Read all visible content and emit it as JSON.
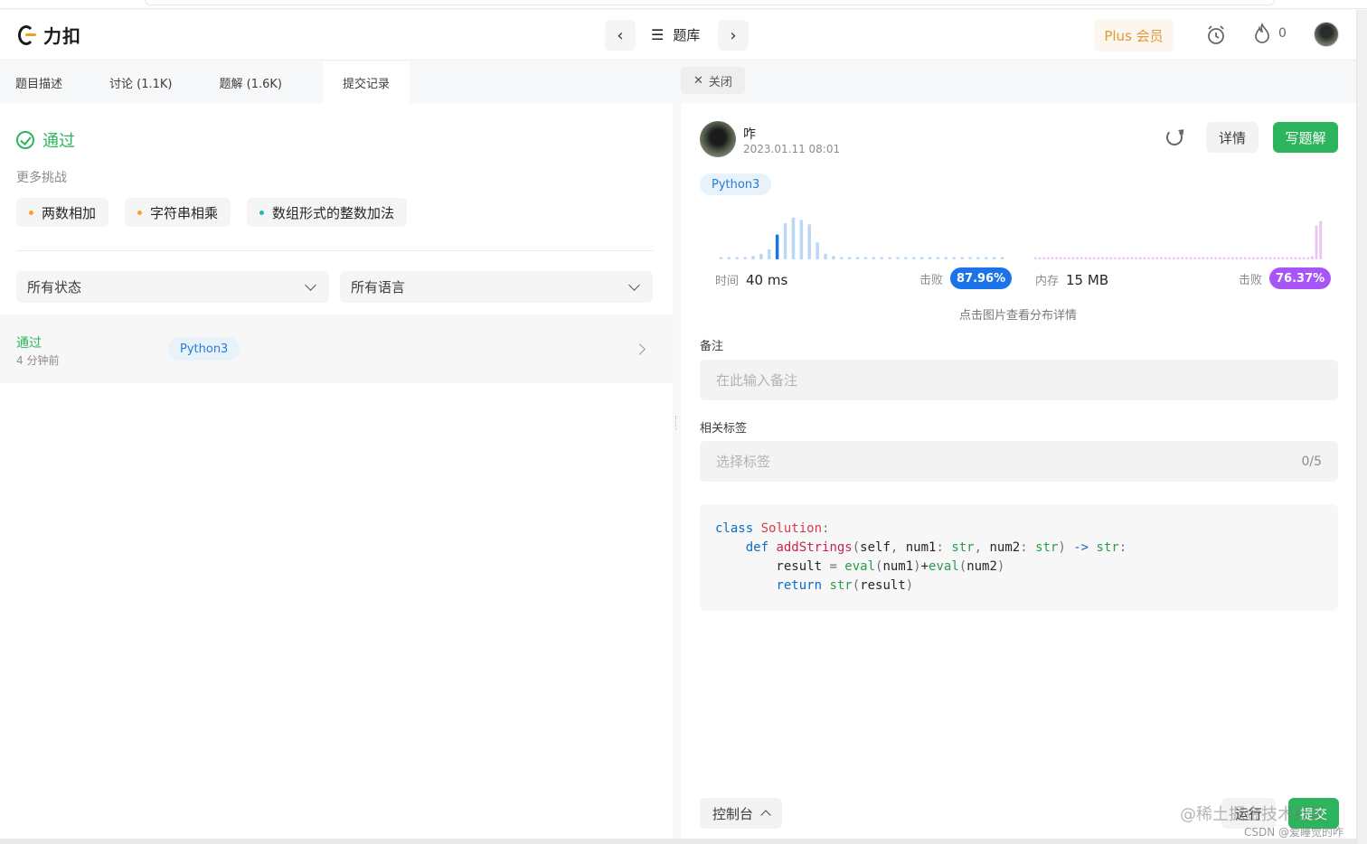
{
  "header": {
    "brand": "力扣",
    "problem_list": "题库",
    "plus": "Plus 会员",
    "streak_count": "0"
  },
  "left_tabs": [
    {
      "label": "题目描述"
    },
    {
      "label": "讨论 (1.1K)"
    },
    {
      "label": "题解 (1.6K)"
    },
    {
      "label": "提交记录",
      "active": true
    }
  ],
  "result": {
    "status": "通过",
    "more_title": "更多挑战",
    "challenges": [
      {
        "label": "两数相加",
        "dot_color": "#f5a623"
      },
      {
        "label": "字符串相乘",
        "dot_color": "#f5a623"
      },
      {
        "label": "数组形式的整数加法",
        "dot_color": "#1cbab0"
      }
    ]
  },
  "filters": {
    "status": "所有状态",
    "language": "所有语言"
  },
  "submission": {
    "status": "通过",
    "time": "4 分钟前",
    "language": "Python3"
  },
  "detail": {
    "close": "关闭",
    "user": "咋",
    "date": "2023.01.11 08:01",
    "details_btn": "详情",
    "write_solution_btn": "写题解",
    "language": "Python3",
    "runtime_label": "时间",
    "runtime_value": "40 ms",
    "beats_label": "击败",
    "runtime_beats": "87.96%",
    "memory_label": "内存",
    "memory_value": "15 MB",
    "memory_beats": "76.37%",
    "hint": "点击图片查看分布详情",
    "note_label": "备注",
    "note_placeholder": "在此输入备注",
    "tags_label": "相关标签",
    "tags_placeholder": "选择标签",
    "tags_count": "0/5",
    "code_lines": [
      "class Solution:",
      "    def addStrings(self, num1: str, num2: str) -> str:",
      "        result = eval(num1)+eval(num2)",
      "        return str(result)"
    ],
    "console_btn": "控制台",
    "run_btn": "运行",
    "submit_btn": "提交"
  },
  "colors": {
    "accent_green": "#2db55d",
    "runtime_blue": "#1a73e8",
    "memory_purple": "#a855f7",
    "plus_orange": "#e09a36"
  },
  "runtime_distribution": [
    2,
    2,
    2,
    2,
    3,
    5,
    9,
    22,
    32,
    37,
    35,
    31,
    15,
    5,
    3,
    2,
    2,
    2,
    2,
    2,
    2,
    2,
    2,
    2,
    2,
    2,
    2,
    2,
    2,
    2,
    2,
    2,
    2,
    2,
    2,
    2
  ],
  "runtime_highlight_index": 7,
  "memory_distribution_tail": [
    2,
    2,
    2,
    2,
    2,
    2,
    2,
    2,
    2,
    2,
    2,
    2,
    2,
    2,
    2,
    2,
    2,
    2,
    2,
    2,
    2,
    2,
    2,
    2,
    2,
    2,
    2,
    2,
    2,
    2,
    2,
    2,
    2,
    2,
    2,
    2,
    2,
    2,
    2,
    2,
    2,
    2,
    2,
    2,
    2,
    2,
    2,
    2,
    2,
    2,
    2,
    2,
    2,
    2,
    2,
    2,
    2,
    2,
    2,
    2,
    2,
    2,
    2,
    2,
    2,
    2,
    3,
    30,
    34
  ],
  "watermark": {
    "line1": "@稀土掘金技术社区",
    "line2": "CSDN @爱睡觉的咋"
  }
}
